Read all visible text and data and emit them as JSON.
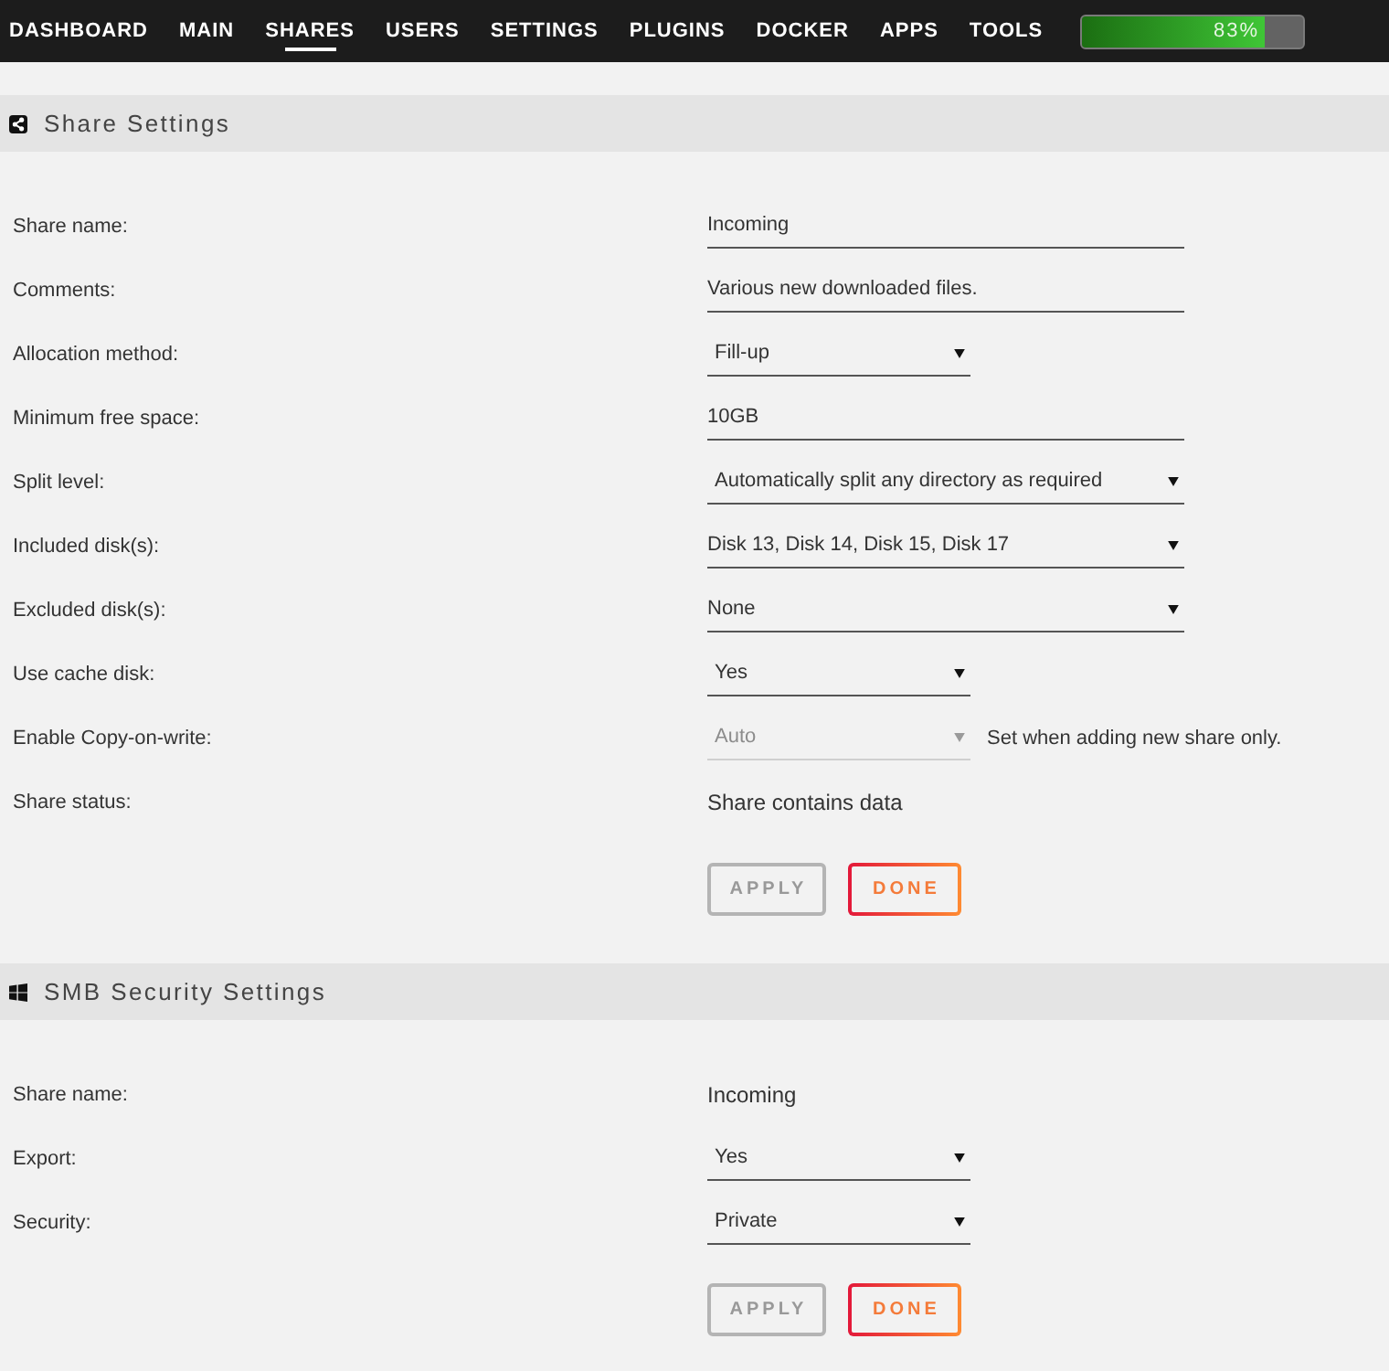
{
  "nav": {
    "tabs": [
      {
        "label": "DASHBOARD",
        "selected": false
      },
      {
        "label": "MAIN",
        "selected": false
      },
      {
        "label": "SHARES",
        "selected": true
      },
      {
        "label": "USERS",
        "selected": false
      },
      {
        "label": "SETTINGS",
        "selected": false
      },
      {
        "label": "PLUGINS",
        "selected": false
      },
      {
        "label": "DOCKER",
        "selected": false
      },
      {
        "label": "APPS",
        "selected": false
      },
      {
        "label": "TOOLS",
        "selected": false
      }
    ],
    "usage": {
      "level": 0.83,
      "reading": "83%"
    }
  },
  "sections": [
    {
      "title": "Share Settings",
      "rows": [
        {
          "label": "Share name:",
          "kind": "input",
          "value": "Incoming",
          "disabled": false
        },
        {
          "label": "Comments:",
          "kind": "input",
          "value": "Various new downloaded files.",
          "disabled": false
        },
        {
          "label": "Allocation method:",
          "kind": "dropdown",
          "value": "Fill-up",
          "disabled": false
        },
        {
          "label": "Minimum free space:",
          "kind": "input",
          "value": "10GB",
          "disabled": false
        },
        {
          "label": "Split level:",
          "kind": "wide-dropdown",
          "value": "Automatically split any directory as required",
          "disabled": false
        },
        {
          "label": "Included disk(s):",
          "kind": "multiselect",
          "value": "Disk 13, Disk 14, Disk 15, Disk 17",
          "disabled": false
        },
        {
          "label": "Excluded disk(s):",
          "kind": "multiselect",
          "value": "None",
          "disabled": false
        },
        {
          "label": "Use cache disk:",
          "kind": "dropdown",
          "value": "Yes",
          "disabled": false
        },
        {
          "label": "Enable Copy-on-write:",
          "kind": "dropdown",
          "value": "Auto",
          "disabled": true,
          "note": "Set when adding new share only."
        },
        {
          "label": "Share status:",
          "kind": "static",
          "value": "Share contains data",
          "disabled": false
        }
      ],
      "buttons": [
        {
          "label": "APPLY",
          "disabled": true
        },
        {
          "label": "DONE",
          "disabled": false
        }
      ]
    },
    {
      "title": "SMB Security Settings",
      "rows": [
        {
          "label": "Share name:",
          "kind": "static",
          "value": "Incoming",
          "disabled": false
        },
        {
          "label": "Export:",
          "kind": "dropdown",
          "value": "Yes",
          "disabled": false
        },
        {
          "label": "Security:",
          "kind": "dropdown",
          "value": "Private",
          "disabled": false
        }
      ],
      "buttons": [
        {
          "label": "APPLY",
          "disabled": true
        },
        {
          "label": "DONE",
          "disabled": false
        }
      ]
    }
  ]
}
